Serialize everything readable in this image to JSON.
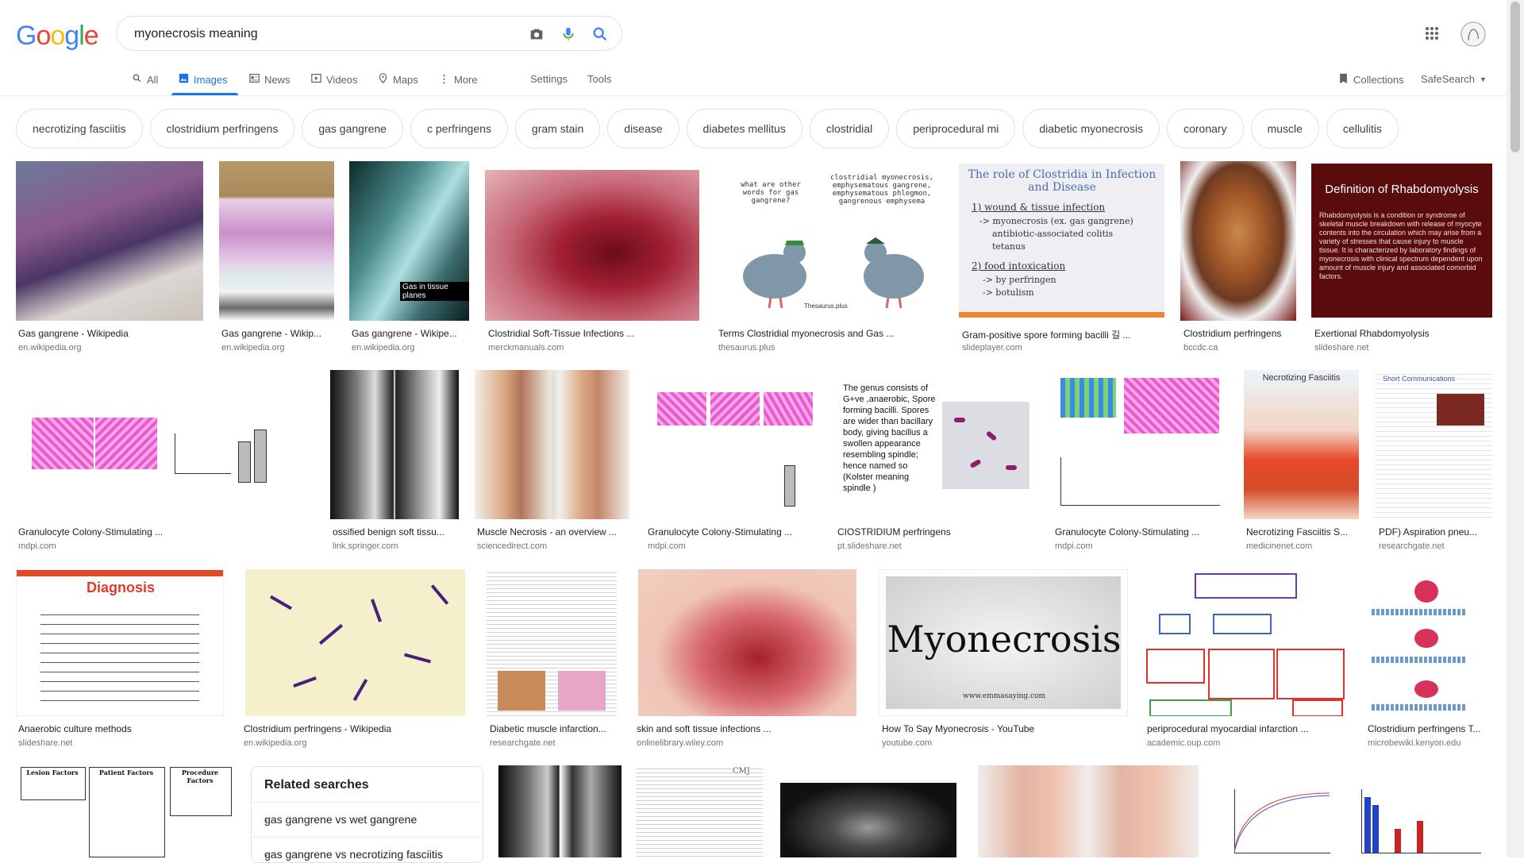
{
  "logo": "Google",
  "search": {
    "query": "myonecrosis meaning"
  },
  "tabs": [
    {
      "label": "All"
    },
    {
      "label": "Images"
    },
    {
      "label": "News"
    },
    {
      "label": "Videos"
    },
    {
      "label": "Maps"
    },
    {
      "label": "More"
    }
  ],
  "settings": "Settings",
  "tools": "Tools",
  "collections": "Collections",
  "safesearch": "SafeSearch",
  "chips": [
    "necrotizing fasciitis",
    "clostridium perfringens",
    "gas gangrene",
    "c perfringens",
    "gram stain",
    "disease",
    "diabetes mellitus",
    "clostridial",
    "periprocedural mi",
    "diabetic myonecrosis",
    "coronary",
    "muscle",
    "cellulitis"
  ],
  "results": [
    {
      "caption": "Gas gangrene - Wikipedia",
      "domain": "en.wikipedia.org"
    },
    {
      "caption": "Gas gangrene - Wikip...",
      "domain": "en.wikipedia.org"
    },
    {
      "caption": "Gas gangrene - Wikipe...",
      "domain": "en.wikipedia.org"
    },
    {
      "caption": "Clostridial Soft-Tissue Infections ...",
      "domain": "merckmanuals.com"
    },
    {
      "caption": "Terms Clostridial myonecrosis and Gas ...",
      "domain": "thesaurus.plus"
    },
    {
      "caption": "Gram-positive spore forming bacilli 길 ...",
      "domain": "slideplayer.com"
    },
    {
      "caption": "Clostridium perfringens",
      "domain": "bccdc.ca"
    },
    {
      "caption": "Exertional Rhabdomyolysis",
      "domain": "slideshare.net"
    },
    {
      "caption": "Granulocyte Colony-Stimulating ...",
      "domain": "mdpi.com"
    },
    {
      "caption": "ossified benign soft tissu...",
      "domain": "link.springer.com"
    },
    {
      "caption": "Muscle Necrosis - an overview ...",
      "domain": "sciencedirect.com"
    },
    {
      "caption": "Granulocyte Colony-Stimulating ...",
      "domain": "mdpi.com"
    },
    {
      "caption": "CIOSTRIDIUM perfringens",
      "domain": "pt.slideshare.net"
    },
    {
      "caption": "Granulocyte Colony-Stimulating ...",
      "domain": "mdpi.com"
    },
    {
      "caption": "Necrotizing Fasciitis S...",
      "domain": "medicinenet.com"
    },
    {
      "caption": "PDF) Aspiration pneu...",
      "domain": "researchgate.net"
    },
    {
      "caption": "Anaerobic culture methods",
      "domain": "slideshare.net"
    },
    {
      "caption": "Clostridium perfringens - Wikipedia",
      "domain": "en.wikipedia.org"
    },
    {
      "caption": "Diabetic muscle infarction...",
      "domain": "researchgate.net"
    },
    {
      "caption": "skin and soft tissue infections ...",
      "domain": "onlinelibrary.wiley.com"
    },
    {
      "caption": "How To Say Myonecrosis - YouTube",
      "domain": "youtube.com"
    },
    {
      "caption": "periprocedural myocardial infarction ...",
      "domain": "academic.oup.com"
    },
    {
      "caption": "Clostridium perfringens T...",
      "domain": "microbewiki.kenyon.edu"
    }
  ],
  "image_text": {
    "gas": "Gas in tissue planes",
    "pig_q": "what are other words for gas gangrene?",
    "pig_a": "clostridial myonecrosis, emphysematous gangrene, emphysematous phlegmon, gangrenous emphysema",
    "pig_src": "Thesaurus.plus",
    "clos_title": "The role of Clostridia in Infection and Disease",
    "clos_1": "1) wound & tissue infection",
    "clos_1a": "-> myonecrosis (ex. gas gangrene)",
    "clos_1b": "antibiotic-associated colitis",
    "clos_1c": "tetanus",
    "clos_2": "2) food intoxication",
    "clos_2a": "-> by perfringen",
    "clos_2b": "-> botulism",
    "rhabdo_title": "Definition of Rhabdomyolysis",
    "rhabdo_body": "Rhabdomyolysis is a condition or syndrome of skeletal muscle breakdown with release of myocyte contents into the circulation which may arise from a variety of stresses that cause injury to muscle tissue. It is characterized by laboratory findings of myonecrosis with clinical spectrum dependent upon amount of muscle injury and associated comorbid factors.",
    "genus": "The genus consists of G+ve ,anaerobic, Spore forming bacilli. Spores are wider than bacillary body, giving bacillus a swollen appearance resembling spindle; hence named so (Kolster meaning spindle )",
    "necfas": "Necrotizing Fasciitis",
    "short_comm": "Short Communications",
    "diagnosis": "Diagnosis",
    "myonecrosis_word": "Myonecrosis",
    "emma": "www.emmasaying.com",
    "lesion": "Lesion Factors",
    "patient": "Patient Factors",
    "procedure": "Procedure Factors",
    "cmj": "CMJ"
  },
  "related": {
    "title": "Related searches",
    "items": [
      "gas gangrene vs wet gangrene",
      "gas gangrene vs necrotizing fasciitis"
    ]
  }
}
